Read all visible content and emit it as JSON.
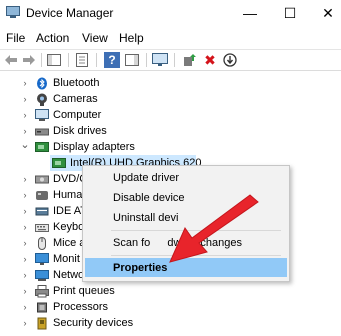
{
  "window": {
    "title": "Device Manager",
    "minimize": "—",
    "maximize": "☐",
    "close": "✕"
  },
  "menu": [
    "File",
    "Action",
    "View",
    "Help"
  ],
  "toolbar": {
    "help_glyph": "?",
    "remove_glyph": "✖",
    "download_glyph": "⬇"
  },
  "tree": [
    {
      "label": "Bluetooth",
      "icon": "bluetooth-icon",
      "chev": "›"
    },
    {
      "label": "Cameras",
      "icon": "camera-icon",
      "chev": "›"
    },
    {
      "label": "Computer",
      "icon": "computer-icon",
      "chev": "›"
    },
    {
      "label": "Disk drives",
      "icon": "disk-icon",
      "chev": "›"
    },
    {
      "label": "Display adapters",
      "icon": "display-icon",
      "chev": "⌄"
    },
    {
      "label": "Intel(R) UHD Graphics 620",
      "icon": "display-icon"
    },
    {
      "label": "DVD/C",
      "icon": "dvd-icon",
      "chev": "›"
    },
    {
      "label": "Huma",
      "icon": "hid-icon",
      "chev": "›"
    },
    {
      "label": "IDE AT",
      "icon": "ide-icon",
      "chev": "›"
    },
    {
      "label": "Keybo",
      "icon": "keyboard-icon",
      "chev": "›"
    },
    {
      "label": "Mice a",
      "icon": "mouse-icon",
      "chev": "›"
    },
    {
      "label": "Monit",
      "icon": "monitor-icon",
      "chev": "›"
    },
    {
      "label": "Netwo",
      "icon": "network-icon",
      "chev": "›"
    },
    {
      "label": "Print queues",
      "icon": "printer-icon",
      "chev": "›"
    },
    {
      "label": "Processors",
      "icon": "processor-icon",
      "chev": "›"
    },
    {
      "label": "Security devices",
      "icon": "security-icon",
      "chev": "›"
    }
  ],
  "context_menu": {
    "items": [
      "Update driver",
      "Disable device",
      "Uninstall devi",
      "Scan fo",
      "dware changes",
      "Properties"
    ]
  },
  "colors": {
    "selection": "#cde8ff",
    "menu_highlight": "#91c9f7",
    "arrow": "#e8242b"
  }
}
